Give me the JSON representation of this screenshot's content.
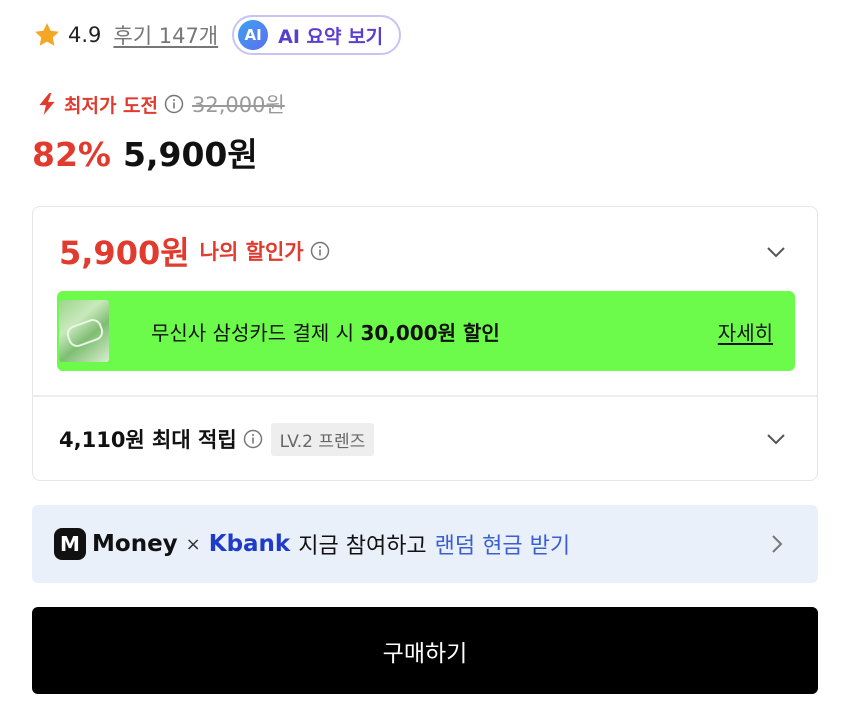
{
  "rating": {
    "icon": "star-icon",
    "value": "4.9",
    "review_link": "후기 147개",
    "ai_badge": "AI",
    "ai_summary_label": "AI 요약 보기"
  },
  "price": {
    "lowest_icon": "bolt-icon",
    "lowest_label": "최저가 도전",
    "original_price": "32,000원",
    "discount_rate": "82%",
    "sale_price": "5,900원"
  },
  "discount_card": {
    "my_price": "5,900원",
    "my_price_label": "나의 할인가",
    "banner": {
      "text_prefix": "무신사 삼성카드 결제 시 ",
      "text_bold": "30,000원 할인",
      "link": "자세히"
    },
    "points": {
      "text": "4,110원 최대 적립",
      "level_badge": "LV.2 프렌즈"
    }
  },
  "promo": {
    "m_icon": "M",
    "money": "Money",
    "times": "×",
    "kbank": "Kbank",
    "text": "지금 참여하고",
    "highlight": "랜덤 현금 받기"
  },
  "buy_button": "구매하기",
  "colors": {
    "accent_red": "#e13a2e",
    "banner_green": "#6dfb4b",
    "ai_purple": "#5a3ed0",
    "kbank_blue": "#1e3cc8"
  }
}
